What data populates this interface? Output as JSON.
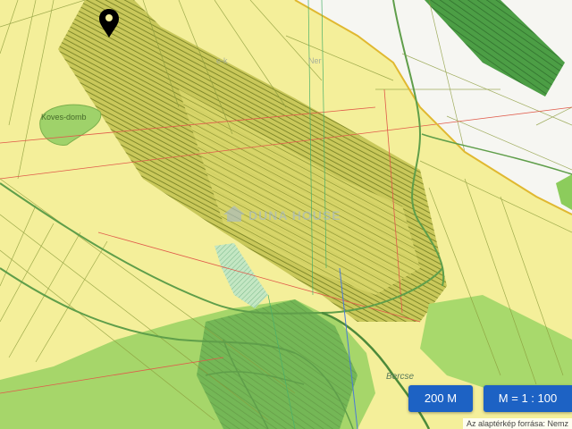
{
  "map": {
    "place_labels": [
      {
        "name": "Koves-domb"
      },
      {
        "name": "Bercse"
      },
      {
        "name": "e-k"
      },
      {
        "name": "Ner"
      }
    ],
    "watermark": "DUNA HOUSE",
    "marker": {
      "icon": "map-pin-icon",
      "color": "#000000"
    }
  },
  "controls": {
    "scale_bar_label": "200 M",
    "scale_ratio_label": "M = 1 : 100"
  },
  "attribution": "Az alaptérkép forrása: Nemz",
  "colors": {
    "farmland": "#f4ef9a",
    "parcel_stripes": "#8e9a2e",
    "urban_green": "#a6d66a",
    "forest": "#3f8f3f",
    "button": "#1d62c4",
    "road": "#5f9e4a"
  }
}
